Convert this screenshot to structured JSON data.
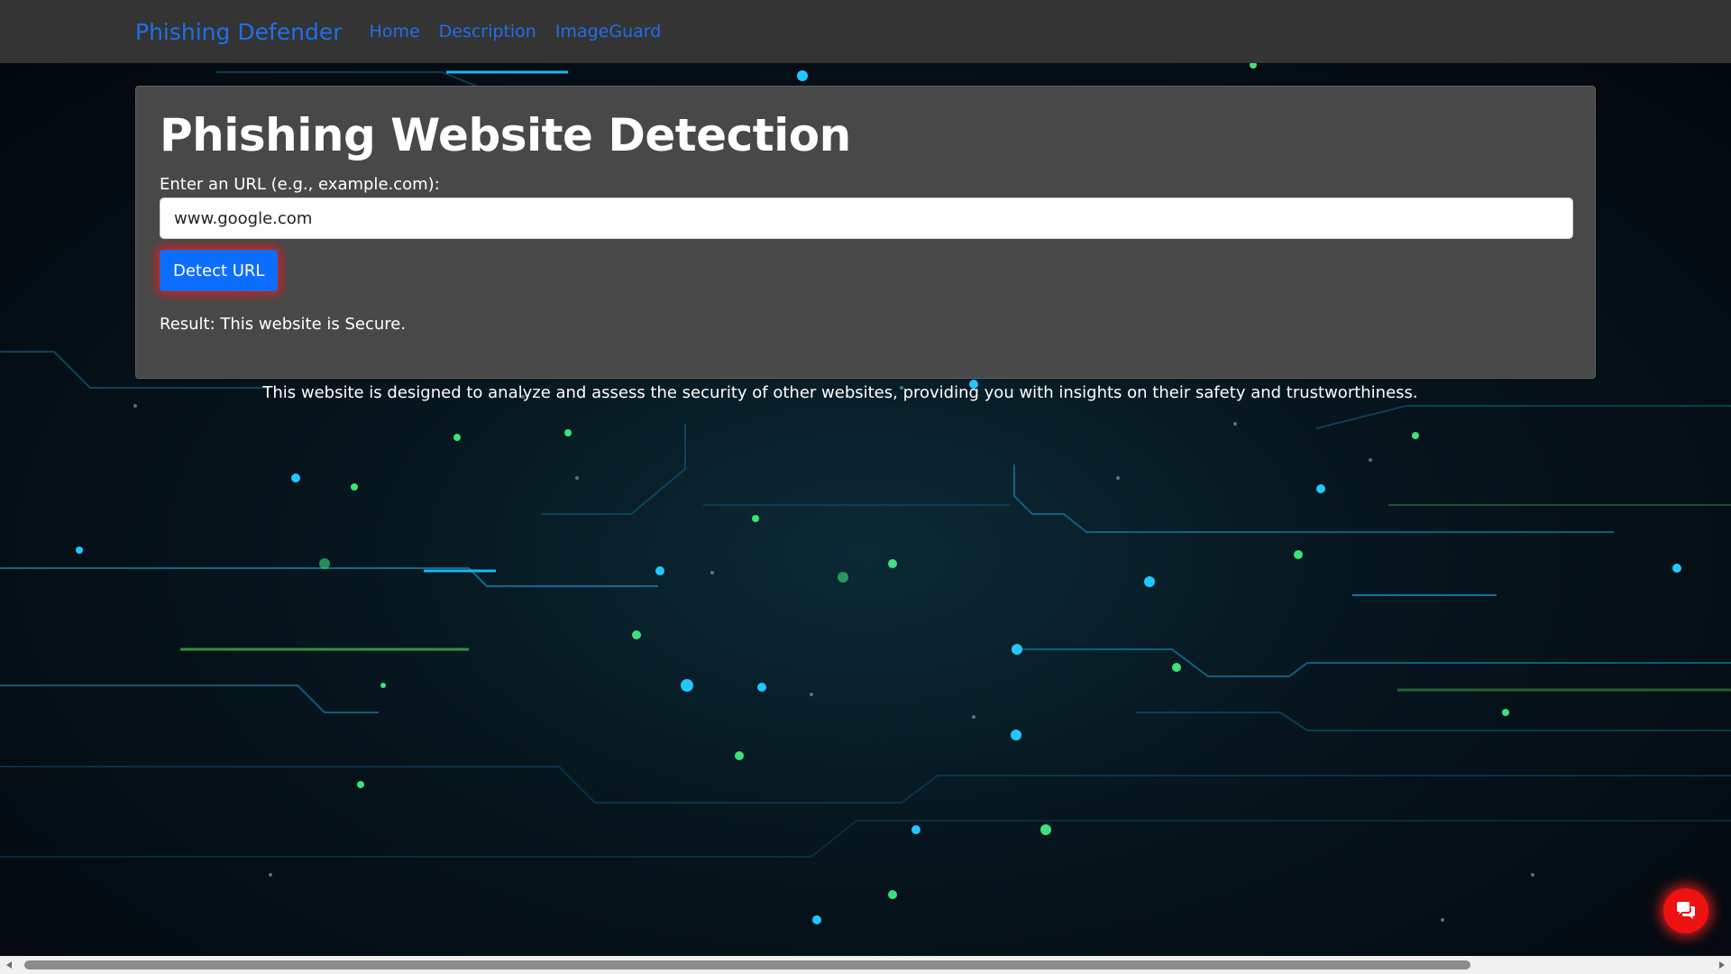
{
  "navbar": {
    "brand": "Phishing Defender",
    "links": [
      "Home",
      "Description",
      "ImageGuard"
    ]
  },
  "card": {
    "title": "Phishing Website Detection",
    "input_label": "Enter an URL (e.g., example.com):",
    "input_value": "www.google.com",
    "button_label": "Detect URL",
    "result": "Result: This website is Secure."
  },
  "description": "This website is designed to analyze and assess the security of other websites, providing you with insights on their safety and trustworthiness.",
  "colors": {
    "navbar_bg": "#343434",
    "link": "#1f6fe8",
    "card_bg": "#484848",
    "button": "#0d6efd",
    "chat_fab": "#ee1111"
  },
  "icons": {
    "chat_fab": "chat-bubbles-icon",
    "scroll_left": "triangle-left-icon",
    "scroll_right": "triangle-right-icon"
  }
}
